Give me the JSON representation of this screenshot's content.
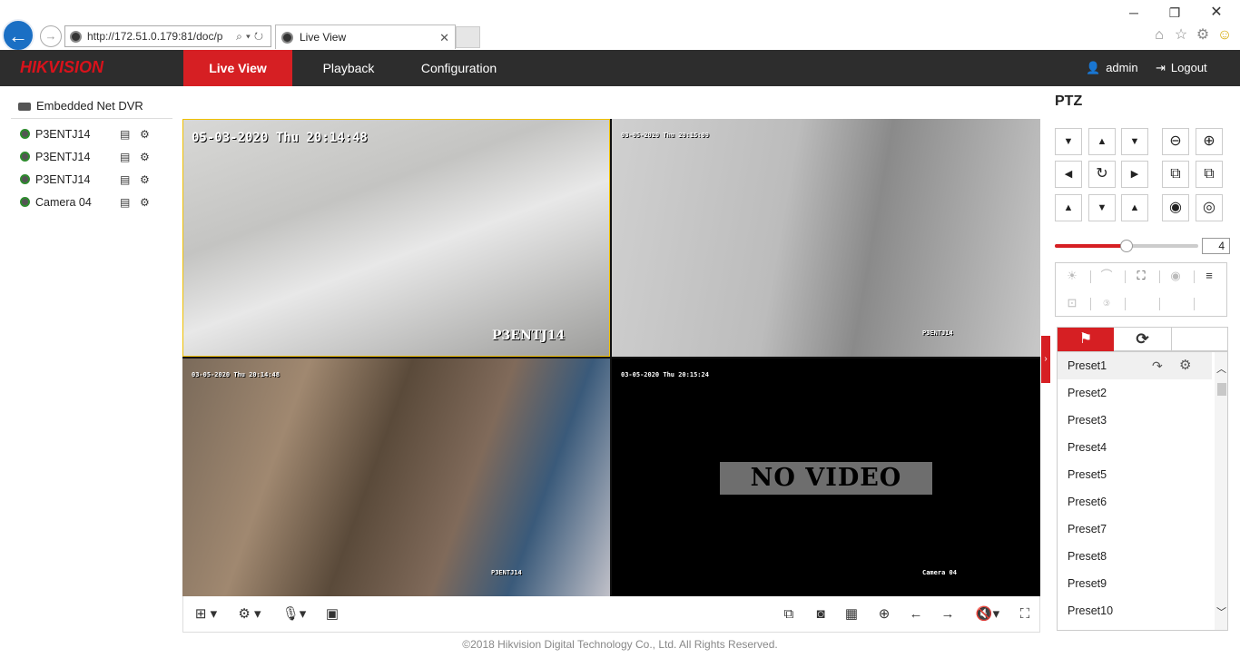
{
  "browser": {
    "url": "http://172.51.0.179:81/doc/p",
    "tab_title": "Live View",
    "tab_close": "✕"
  },
  "brand": {
    "logo_text": "HIKVISION",
    "accent": "#d61f23"
  },
  "nav": {
    "tabs": [
      {
        "label": "Live View",
        "active": true
      },
      {
        "label": "Playback",
        "active": false
      },
      {
        "label": "Configuration",
        "active": false
      }
    ],
    "user": "admin",
    "logout": "Logout"
  },
  "tree": {
    "root": "Embedded Net DVR",
    "cameras": [
      {
        "name": "P3ENTJ14"
      },
      {
        "name": "P3ENTJ14"
      },
      {
        "name": "P3ENTJ14"
      },
      {
        "name": "Camera 04"
      }
    ]
  },
  "video": {
    "panes": [
      {
        "timestamp": "05-03-2020 Thu 20:14:48",
        "channel": "P3ENTJ14"
      },
      {
        "timestamp": "03-05-2020 Thu 20:15:09",
        "channel": "P3ENTJ14"
      },
      {
        "timestamp": "03-05-2020 Thu 20:14:48",
        "channel": "P3ENTJ14"
      },
      {
        "timestamp": "03-05-2020 Thu 20:15:24",
        "channel": "Camera 04",
        "message": "NO VIDEO"
      }
    ]
  },
  "ptz": {
    "title": "PTZ",
    "speed": "4",
    "speed_level": 0.5,
    "presets": [
      "Preset1",
      "Preset2",
      "Preset3",
      "Preset4",
      "Preset5",
      "Preset6",
      "Preset7",
      "Preset8",
      "Preset9",
      "Preset10"
    ]
  },
  "footer": "©2018 Hikvision Digital Technology Co., Ltd. All Rights Reserved."
}
